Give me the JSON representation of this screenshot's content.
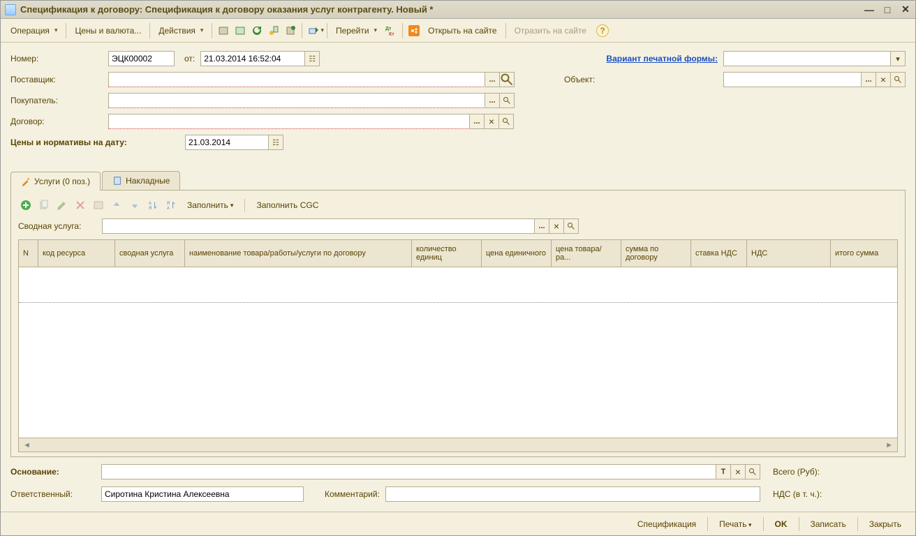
{
  "title": "Спецификация к договору: Спецификация к договору оказания услуг контрагенту. Новый *",
  "toolbar": {
    "operation": "Операция",
    "prices": "Цены и валюта...",
    "actions": "Действия",
    "goto": "Перейти",
    "open_site": "Открыть на сайте",
    "reflect_site": "Отразить на сайте"
  },
  "form": {
    "number_label": "Номер:",
    "number_value": "ЭЦК00002",
    "from_label": "от:",
    "date_value": "21.03.2014 16:52:04",
    "supplier_label": "Поставщик:",
    "supplier_value": "",
    "buyer_label": "Покупатель:",
    "buyer_value": "",
    "contract_label": "Договор:",
    "contract_value": "",
    "prices_date_label": "Цены и нормативы на дату:",
    "prices_date_value": "21.03.2014",
    "print_variant_label": "Вариант печатной формы:",
    "print_variant_value": "",
    "object_label": "Объект:",
    "object_value": ""
  },
  "tabs": {
    "services": "Услуги (0 поз.)",
    "invoices": "Накладные"
  },
  "inner": {
    "fill": "Заполнить",
    "fill_cgc": "Заполнить CGC",
    "summary_label": "Сводная услуга:",
    "summary_value": ""
  },
  "columns": {
    "n": "N",
    "res_code": "код ресурса",
    "summary": "сводная услуга",
    "name": "наименование товара/работы/услуги по договору",
    "qty": "количество единиц",
    "unit_price": "цена единичного",
    "item_price": "цена товара/ра...",
    "sum": "сумма по договору",
    "vat_rate": "ставка НДС",
    "vat": "НДС",
    "total": "итого сумма"
  },
  "footer": {
    "basis_label": "Основание:",
    "basis_value": "",
    "responsible_label": "Ответственный:",
    "responsible_value": "Сиротина Кристина Алексеевна",
    "comment_label": "Комментарий:",
    "comment_value": "",
    "total_label": "Всего (Руб):",
    "vat_label": "НДС (в т. ч.):"
  },
  "buttons": {
    "spec": "Спецификация",
    "print": "Печать",
    "ok": "OK",
    "save": "Записать",
    "close": "Закрыть"
  }
}
